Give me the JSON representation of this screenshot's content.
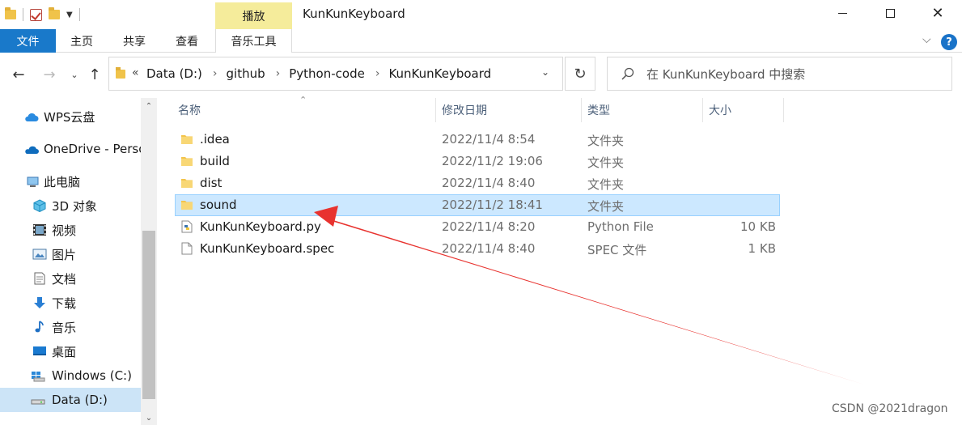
{
  "window": {
    "title": "KunKunKeyboard",
    "contextual_tab_header": "播放",
    "minimize_icon": "minimize-icon",
    "maximize_icon": "maximize-icon",
    "close_glyph": "✕"
  },
  "ribbon": {
    "tabs": [
      "文件",
      "主页",
      "共享",
      "查看",
      "音乐工具"
    ],
    "expand_glyph": "⌵",
    "help_glyph": "?",
    "accent_color": "#1979ca",
    "contextual_color": "#f5ec9b"
  },
  "navigation": {
    "back_glyph": "←",
    "forward_glyph": "→",
    "recent_glyph": "⌄",
    "up_glyph": "↑",
    "overflow_glyph": "«",
    "breadcrumbs": [
      "Data (D:)",
      "github",
      "Python-code",
      "KunKunKeyboard"
    ],
    "separator": "›",
    "dropdown_glyph": "⌄",
    "refresh_glyph": "↻",
    "search_placeholder": "在 KunKunKeyboard 中搜索"
  },
  "sidebar": {
    "items": [
      {
        "label": "WPS云盘",
        "icon": "cloud-icon"
      },
      {
        "label": "OneDrive - Personal",
        "icon": "onedrive-icon"
      },
      {
        "label": "此电脑",
        "icon": "computer-icon"
      },
      {
        "label": "3D 对象",
        "icon": "cube-icon"
      },
      {
        "label": "视频",
        "icon": "video-icon"
      },
      {
        "label": "图片",
        "icon": "picture-icon"
      },
      {
        "label": "文档",
        "icon": "document-icon"
      },
      {
        "label": "下载",
        "icon": "download-icon"
      },
      {
        "label": "音乐",
        "icon": "music-icon"
      },
      {
        "label": "桌面",
        "icon": "desktop-icon"
      },
      {
        "label": "Windows (C:)",
        "icon": "windows-drive-icon"
      },
      {
        "label": "Data (D:)",
        "icon": "drive-icon",
        "selected": true
      }
    ],
    "scroll_up_glyph": "⌃",
    "scroll_down_glyph": "⌄"
  },
  "file_list": {
    "columns": [
      "名称",
      "修改日期",
      "类型",
      "大小"
    ],
    "sort_glyph": "⌃",
    "rows": [
      {
        "name": ".idea",
        "date": "2022/11/4 8:54",
        "type": "文件夹",
        "size": "",
        "icon": "folder-icon"
      },
      {
        "name": "build",
        "date": "2022/11/2 19:06",
        "type": "文件夹",
        "size": "",
        "icon": "folder-icon"
      },
      {
        "name": "dist",
        "date": "2022/11/4 8:40",
        "type": "文件夹",
        "size": "",
        "icon": "folder-icon"
      },
      {
        "name": "sound",
        "date": "2022/11/2 18:41",
        "type": "文件夹",
        "size": "",
        "icon": "folder-icon",
        "selected": true
      },
      {
        "name": "KunKunKeyboard.py",
        "date": "2022/11/4 8:20",
        "type": "Python File",
        "size": "10 KB",
        "icon": "python-file-icon"
      },
      {
        "name": "KunKunKeyboard.spec",
        "date": "2022/11/4 8:40",
        "type": "SPEC 文件",
        "size": "1 KB",
        "icon": "blank-file-icon"
      }
    ]
  },
  "annotation": {
    "arrow_color": "#e8332f"
  },
  "watermark": "CSDN @2021dragon"
}
